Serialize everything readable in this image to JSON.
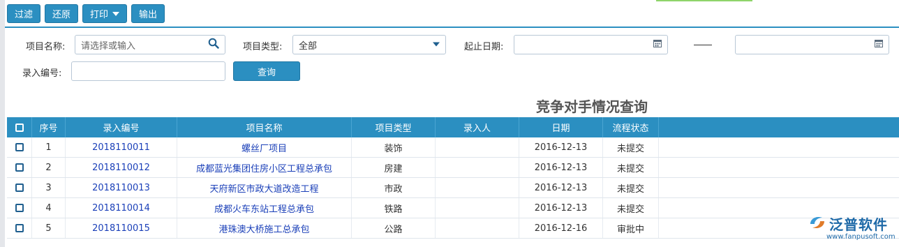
{
  "toolbar": {
    "filter_label": "过滤",
    "restore_label": "还原",
    "print_label": "打印",
    "export_label": "输出"
  },
  "filters": {
    "project_name_label": "项目名称:",
    "project_name_placeholder": "请选择或输入",
    "project_type_label": "项目类型:",
    "project_type_value": "全部",
    "date_range_label": "起止日期:",
    "entry_no_label": "录入编号:",
    "query_label": "查询"
  },
  "report": {
    "title": "竞争对手情况查询"
  },
  "table": {
    "columns": [
      "序号",
      "录入编号",
      "项目名称",
      "项目类型",
      "录入人",
      "日期",
      "流程状态"
    ],
    "rows": [
      {
        "no": "1",
        "code": "2018110011",
        "name": "螺丝厂项目",
        "type": "装饰",
        "user": "",
        "date": "2016-12-13",
        "status": "未提交"
      },
      {
        "no": "2",
        "code": "2018110012",
        "name": "成都蓝光集团住房小区工程总承包",
        "type": "房建",
        "user": "",
        "date": "2016-12-13",
        "status": "未提交"
      },
      {
        "no": "3",
        "code": "2018110013",
        "name": "天府新区市政大道改造工程",
        "type": "市政",
        "user": "",
        "date": "2016-12-13",
        "status": "未提交"
      },
      {
        "no": "4",
        "code": "2018110014",
        "name": "成都火车东站工程总承包",
        "type": "铁路",
        "user": "",
        "date": "2016-12-13",
        "status": "未提交"
      },
      {
        "no": "5",
        "code": "2018110015",
        "name": "港珠澳大桥施工总承包",
        "type": "公路",
        "user": "",
        "date": "2016-12-16",
        "status": "审批中"
      }
    ]
  },
  "brand": {
    "name": "泛普软件",
    "url": "www.fanpusoft.com",
    "logo_icon": "fanpu-logo-icon"
  },
  "colors": {
    "primary": "#2b8fc1",
    "link": "#1a3fb8",
    "brand": "#1f6aa8"
  }
}
